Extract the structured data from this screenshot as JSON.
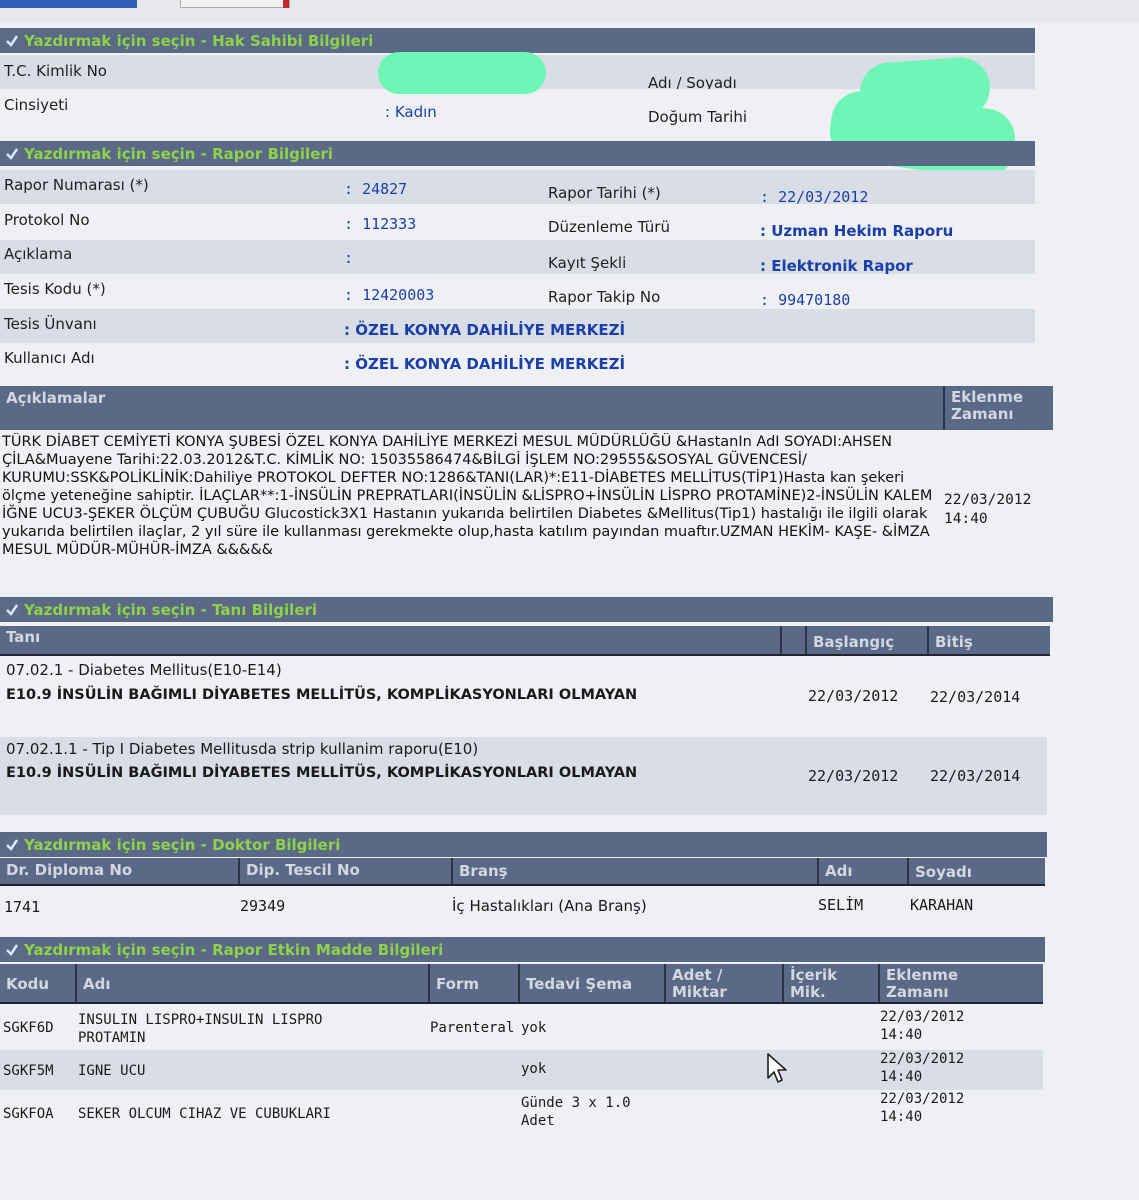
{
  "sections": {
    "hak_sahibi": "Yazdırmak için seçin - Hak Sahibi Bilgileri",
    "rapor": "Yazdırmak için seçin - Rapor Bilgileri",
    "tani": "Yazdırmak için seçin - Tanı Bilgileri",
    "doktor": "Yazdırmak için seçin - Doktor Bilgileri",
    "etkin_madde": "Yazdırmak için seçin - Rapor Etkin Madde Bilgileri"
  },
  "hak_sahibi": {
    "tc_label": "T.C. Kimlik No",
    "ad_soyad_label": "Adı / Soyadı",
    "cinsiyet_label": "Cinsiyeti",
    "cinsiyet_value": "Kadın",
    "dogum_label": "Doğum Tarihi"
  },
  "rapor": {
    "rapor_no_label": "Rapor Numarası (*)",
    "rapor_no_value": "24827",
    "rapor_tarihi_label": "Rapor Tarihi (*)",
    "rapor_tarihi_value": "22/03/2012",
    "protokol_label": "Protokol No",
    "protokol_value": "112333",
    "duzenleme_label": "Düzenleme Türü",
    "duzenleme_value": "Uzman Hekim Raporu",
    "aciklama_label": "Açıklama",
    "kayit_label": "Kayıt Şekli",
    "kayit_value": "Elektronik Rapor",
    "tesis_kodu_label": "Tesis Kodu (*)",
    "tesis_kodu_value": "12420003",
    "takip_label": "Rapor Takip No",
    "takip_value": "99470180",
    "tesis_unvani_label": "Tesis Ünvanı",
    "tesis_unvani_value": "ÖZEL KONYA DAHİLİYE MERKEZİ",
    "kullanici_label": "Kullanıcı Adı",
    "kullanici_value": "ÖZEL KONYA DAHİLİYE MERKEZİ"
  },
  "aciklamalar": {
    "header": "Açıklamalar",
    "eklenme_header": "Eklenme Zamanı",
    "text": "TÜRK DİABET CEMİYETİ KONYA ŞUBESİ ÖZEL KONYA DAHİLİYE MERKEZİ MESUL MÜDÜRLÜĞÜ &HastanIn AdI SOYADI:AHSEN ÇİLA&Muayene Tarihi:22.03.2012&T.C. KİMLİK NO: 15035586474&BİLGİ İŞLEM NO:29555&SOSYAL GÜVENCESİ/ KURUMU:SSK&POLİKLİNİK:Dahiliye PROTOKOL DEFTER NO:1286&TANI(LAR)*:E11-DİABETES MELLİTUS(TİP1)Hasta kan şekeri ölçme yeteneğine sahiptir. İLAÇLAR**:1-İNSÜLİN PREPRATLARI(İNSÜLİN &LİSPRO+İNSÜLİN LİSPRO PROTAMİNE)2-İNSÜLİN KALEM İĞNE UCU3-ŞEKER ÖLÇÜM ÇUBUĞU Glucostick3X1 Hastanın yukarıda belirtilen Diabetes &Mellitus(Tip1) hastalığı ile ilgili olarak yukarıda belirtilen ilaçlar, 2 yıl süre ile kullanması gerekmekte olup,hasta katılım payından muaftır.UZMAN HEKİM- KAŞE- &İMZA MESUL MÜDÜR-MÜHÜR-İMZA &&&&&",
    "date": "22/03/2012",
    "time": "14:40"
  },
  "tani": {
    "headers": {
      "tani": "Tanı",
      "baslangic": "Başlangıç",
      "bitis": "Bitiş"
    },
    "items": [
      {
        "group": "07.02.1 - Diabetes Mellitus(E10-E14)",
        "desc": "E10.9 İNSÜLİN BAĞIMLI DİYABETES MELLİTÜS, KOMPLİKASYONLARI OLMAYAN",
        "baslangic": "22/03/2012",
        "bitis": "22/03/2014"
      },
      {
        "group": "07.02.1.1 - Tip I Diabetes Mellitusda strip kullanim raporu(E10)",
        "desc": "E10.9 İNSÜLİN BAĞIMLI DİYABETES MELLİTÜS, KOMPLİKASYONLARI OLMAYAN",
        "baslangic": "22/03/2012",
        "bitis": "22/03/2014"
      }
    ]
  },
  "doktor": {
    "headers": {
      "diploma": "Dr. Diploma No",
      "tescil": "Dip. Tescil No",
      "brans": "Branş",
      "adi": "Adı",
      "soyadi": "Soyadı"
    },
    "row": {
      "diploma": "1741",
      "tescil": "29349",
      "brans": "İç Hastalıkları (Ana Branş)",
      "adi": "SELİM",
      "soyadi": "KARAHAN"
    }
  },
  "etkin_madde": {
    "headers": {
      "kodu": "Kodu",
      "adi": "Adı",
      "form": "Form",
      "tedavi": "Tedavi Şema",
      "adet": "Adet / Miktar",
      "icerik": "İçerik Mik.",
      "eklenme": "Eklenme Zamanı"
    },
    "rows": [
      {
        "kodu": "SGKF6D",
        "adi": "INSULIN LISPRO+INSULIN LISPRO PROTAMIN",
        "form": "Parenteral",
        "tedavi": "yok",
        "date": "22/03/2012",
        "time": "14:40"
      },
      {
        "kodu": "SGKF5M",
        "adi": "IGNE UCU",
        "form": "",
        "tedavi": "yok",
        "date": "22/03/2012",
        "time": "14:40"
      },
      {
        "kodu": "SGKFOA",
        "adi": "SEKER OLCUM CIHAZ VE CUBUKLARI",
        "form": "",
        "tedavi": "Günde 3 x 1.0 Adet",
        "date": "22/03/2012",
        "time": "14:40"
      }
    ]
  },
  "colors": {
    "section_bg": "#596986",
    "section_text": "#8fd24a",
    "value_blue": "#1b3fa8",
    "redaction": "#6ff5b5"
  }
}
